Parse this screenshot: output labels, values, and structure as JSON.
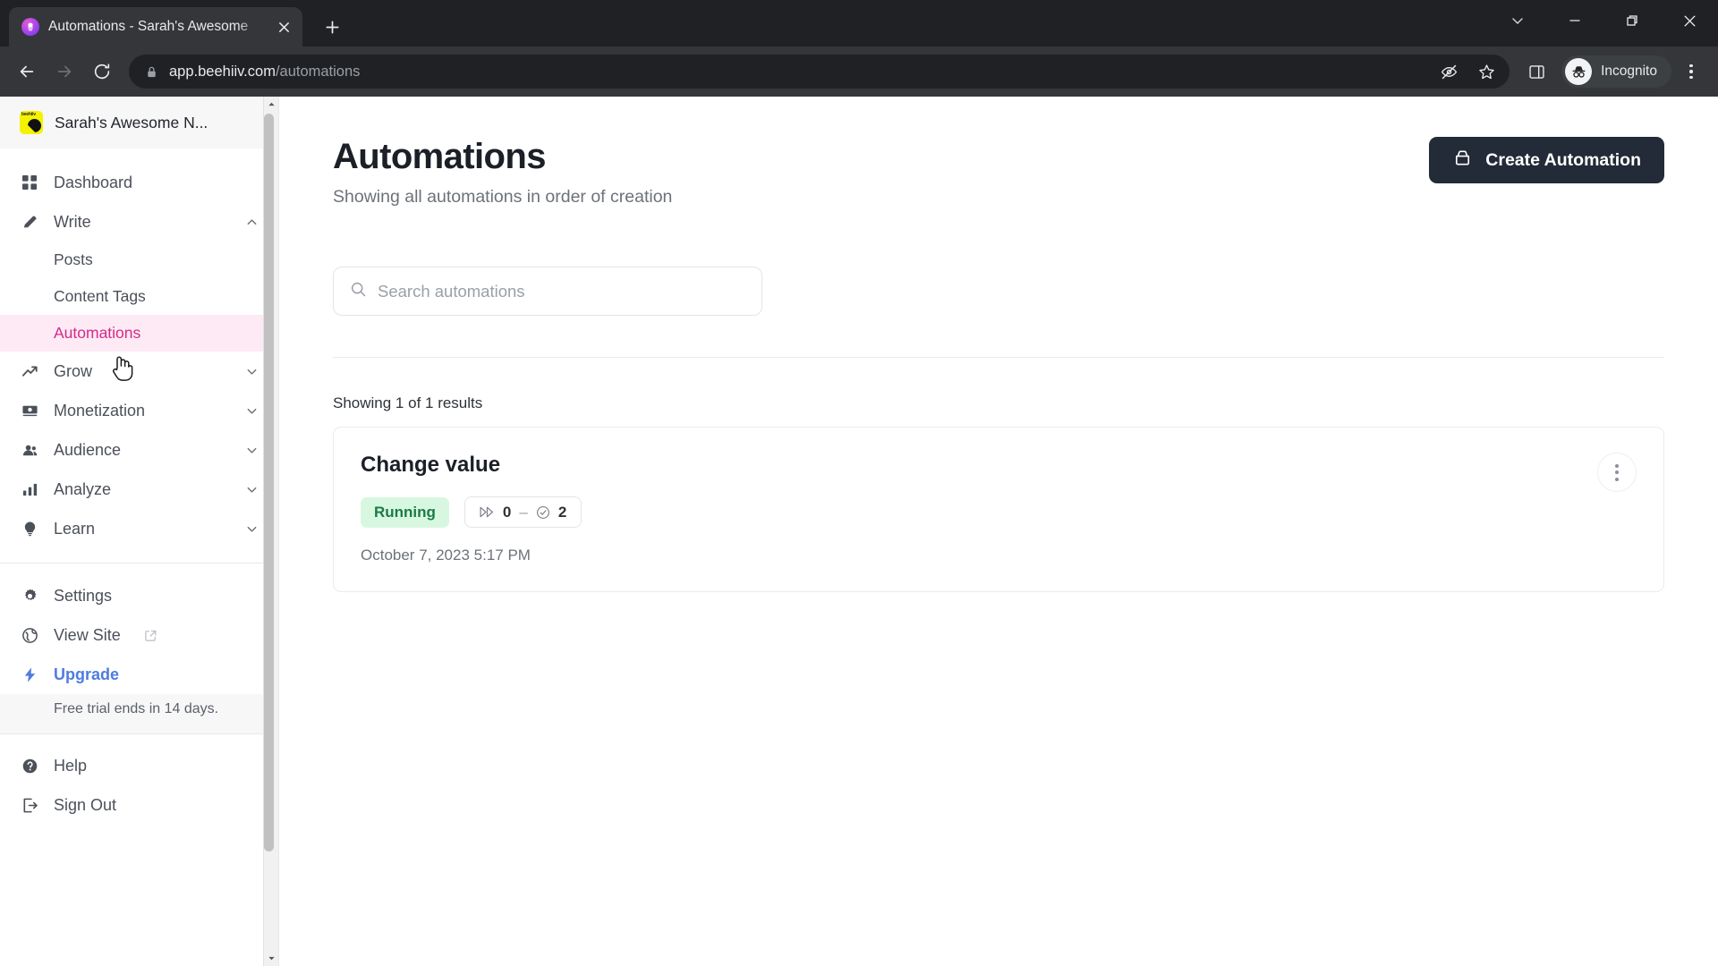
{
  "browser": {
    "tab": {
      "title": "Automations - Sarah's Awesome",
      "favicon": "beehiiv-favicon",
      "close": "close-tab-icon"
    },
    "new_tab": "new-tab-icon",
    "window_controls": {
      "tab_search": "chevron-down-icon",
      "minimize": "minimize-icon",
      "maximize": "restore-icon",
      "close": "close-window-icon"
    },
    "nav": {
      "back": "back-arrow-icon",
      "forward": "forward-arrow-icon",
      "reload": "reload-icon"
    },
    "omnibox": {
      "lock": "lock-icon",
      "url_domain": "app.beehiiv.com",
      "url_path": "/automations"
    },
    "actions": {
      "cookies": "eye-off-icon",
      "bookmark": "star-icon",
      "side_panel": "side-panel-icon",
      "profile": "incognito-icon",
      "profile_label": "Incognito",
      "menu": "kebab-menu-icon"
    }
  },
  "sidebar": {
    "workspace": {
      "name": "Sarah's Awesome N...",
      "logo": "beehiiv-logo",
      "logo_text": "beehiiv"
    },
    "items": [
      {
        "label": "Dashboard",
        "icon": "grid-icon",
        "expandable": false
      },
      {
        "label": "Write",
        "icon": "pencil-icon",
        "expandable": true,
        "chevron": "chevron-up-icon"
      },
      {
        "label": "Grow",
        "icon": "trending-up-icon",
        "expandable": true,
        "chevron": "chevron-down-icon"
      },
      {
        "label": "Monetization",
        "icon": "money-icon",
        "expandable": true,
        "chevron": "chevron-down-icon"
      },
      {
        "label": "Audience",
        "icon": "users-icon",
        "expandable": true,
        "chevron": "chevron-down-icon"
      },
      {
        "label": "Analyze",
        "icon": "bar-chart-icon",
        "expandable": true,
        "chevron": "chevron-down-icon"
      },
      {
        "label": "Learn",
        "icon": "lightbulb-icon",
        "expandable": true,
        "chevron": "chevron-down-icon"
      }
    ],
    "write_children": [
      {
        "label": "Posts",
        "active": false
      },
      {
        "label": "Content Tags",
        "active": false
      },
      {
        "label": "Automations",
        "active": true
      }
    ],
    "footer": [
      {
        "label": "Settings",
        "icon": "gear-icon"
      },
      {
        "label": "View Site",
        "icon": "globe-icon",
        "external": "external-link-icon"
      },
      {
        "label": "Upgrade",
        "icon": "bolt-icon"
      }
    ],
    "trial_notice": "Free trial ends in 14 days.",
    "bottom": [
      {
        "label": "Help",
        "icon": "question-circle-icon"
      },
      {
        "label": "Sign Out",
        "icon": "sign-out-icon"
      }
    ],
    "scrollbar": {
      "up": "scroll-up-arrow",
      "down": "scroll-down-arrow"
    }
  },
  "main": {
    "title": "Automations",
    "subtitle": "Showing all automations in order of creation",
    "create_button": {
      "label": "Create Automation",
      "icon": "automation-box-icon"
    },
    "search": {
      "placeholder": "Search automations",
      "value": "",
      "icon": "search-icon"
    },
    "results_count": "Showing 1 of 1 results",
    "automations": [
      {
        "name": "Change value",
        "status": "Running",
        "status_color": "#1c7a45",
        "status_bg": "#d8f7e1",
        "in_progress_icon": "fast-forward-icon",
        "in_progress_count": "0",
        "separator": "–",
        "completed_icon": "check-circle-icon",
        "completed_count": "2",
        "date": "October 7, 2023 5:17 PM",
        "menu": "kebab-menu-icon"
      }
    ]
  }
}
